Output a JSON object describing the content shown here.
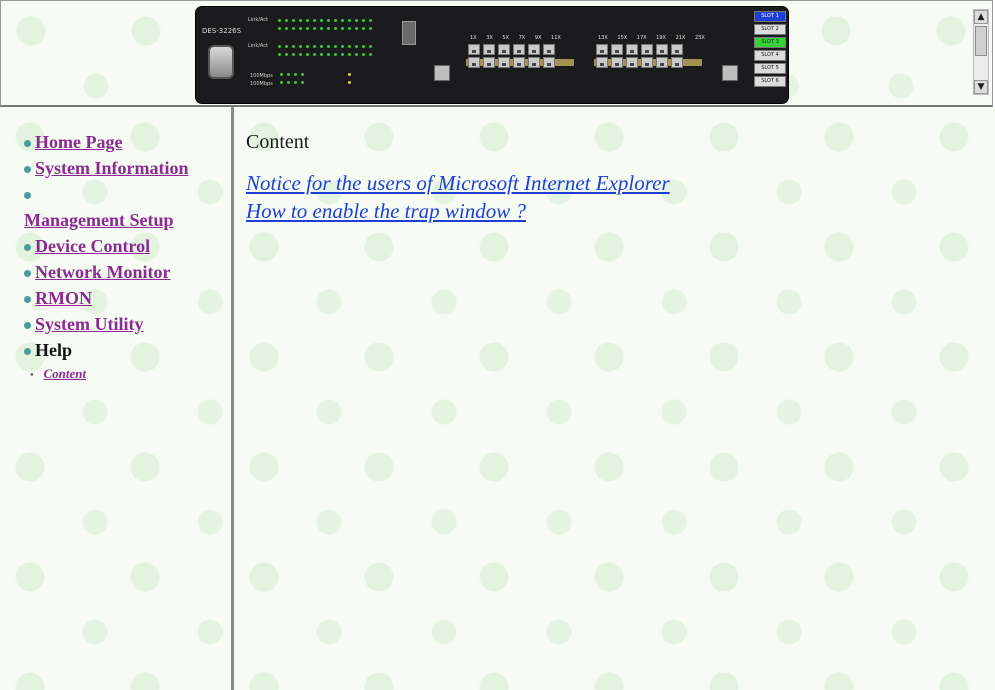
{
  "device": {
    "model": "DES-3226S",
    "port_labels_left": [
      "1X",
      "3X",
      "5X",
      "7X",
      "9X",
      "11X"
    ],
    "port_labels_right": [
      "13X",
      "15X",
      "17X",
      "19X",
      "21X",
      "23X"
    ],
    "slots": [
      "SLOT 1",
      "SLOT 2",
      "SLOT 3",
      "SLOT 4",
      "SLOT 5",
      "SLOT 6"
    ],
    "colors": {
      "panel": "#1b1b1d",
      "active_blue": "#1d3fd6",
      "active_green": "#38d238"
    }
  },
  "nav": {
    "items": [
      {
        "label": "Home Page"
      },
      {
        "label": "System Information"
      },
      {
        "label": "Management Setup"
      },
      {
        "label": "Device Control"
      },
      {
        "label": "Network Monitor"
      },
      {
        "label": "RMON"
      },
      {
        "label": "System Utility"
      },
      {
        "label": "Help"
      }
    ],
    "sub_items": [
      {
        "label": "Content"
      }
    ],
    "colors": {
      "link": "#8b2a93",
      "bullet": "#4b9a9a"
    }
  },
  "content": {
    "title": "Content",
    "links": [
      "Notice for the users of Microsoft Internet Explorer",
      "How to enable the trap window ?"
    ],
    "link_color": "#1d3fd6"
  },
  "scrollbar": {
    "up_glyph": "▲",
    "down_glyph": "▼"
  }
}
